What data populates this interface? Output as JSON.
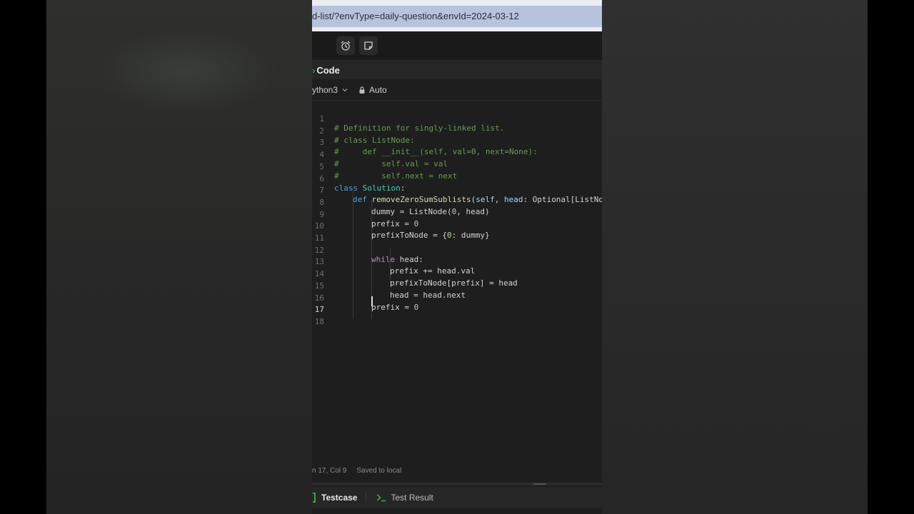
{
  "browser": {
    "url": "d-list/?envType=daily-question&envId=2024-03-12"
  },
  "toolbar": {
    "icons": [
      "alarm-icon",
      "note-icon"
    ]
  },
  "code_panel": {
    "title": "Code",
    "language": "ython3",
    "mode": "Auto"
  },
  "editor": {
    "lines": [
      {
        "n": "1"
      },
      {
        "n": "2"
      },
      {
        "n": "3"
      },
      {
        "n": "4"
      },
      {
        "n": "5"
      },
      {
        "n": "6"
      },
      {
        "n": "7"
      },
      {
        "n": "8"
      },
      {
        "n": "9"
      },
      {
        "n": "10"
      },
      {
        "n": "11"
      },
      {
        "n": "12"
      },
      {
        "n": "13"
      },
      {
        "n": "14"
      },
      {
        "n": "15"
      },
      {
        "n": "16"
      },
      {
        "n": "17"
      },
      {
        "n": "18"
      }
    ],
    "active_line": "17",
    "code": {
      "l1": "# Definition for singly-linked list.",
      "l2": "# class ListNode:",
      "l3": "#     def __init__(self, val=0, next=None):",
      "l4": "#         self.val = val",
      "l5": "#         self.next = next",
      "l6_kw": "class",
      "l6_name": "Solution",
      "l6_rest": ":",
      "l7_kw": "def",
      "l7_fn": "removeZeroSumSublists",
      "l7_open": "(",
      "l7_self": "self",
      "l7_sep": ", ",
      "l7_head": "head",
      "l7_rest": ": Optional[ListNo",
      "l8": "dummy = ListNode(",
      "l8_num": "0",
      "l8_rest": ", head)",
      "l9": "prefix = ",
      "l9_num": "0",
      "l10": "prefixToNode = {",
      "l10_num": "0",
      "l10_rest": ": dummy}",
      "l12_kw": "while",
      "l12_rest": " head:",
      "l13": "prefix += head.val",
      "l14": "prefixToNode[prefix] = head",
      "l15": "head = head.next",
      "l16": "prefix = ",
      "l16_num": "0"
    }
  },
  "status": {
    "position": "n 17, Col 9",
    "saved": "Saved to local"
  },
  "bottom_tabs": {
    "testcase": "Testcase",
    "result": "Test Result"
  }
}
